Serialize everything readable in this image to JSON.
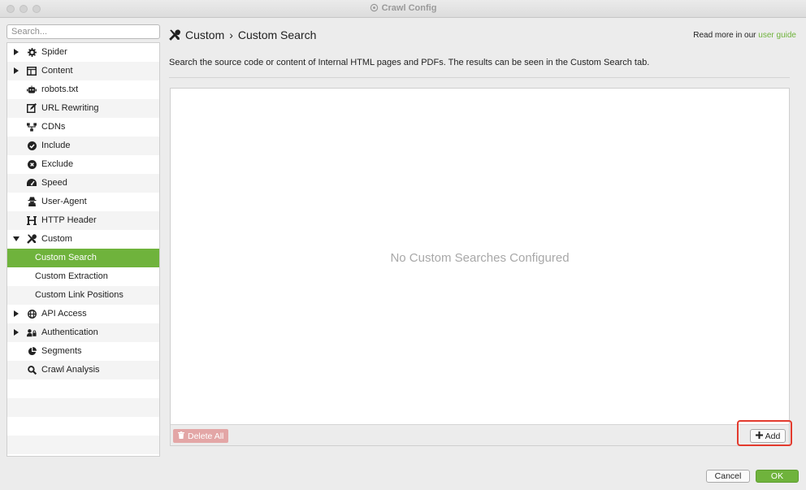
{
  "window": {
    "title": "Crawl Config"
  },
  "sidebar": {
    "search_placeholder": "Search...",
    "items": [
      {
        "label": "Spider",
        "icon": "gear-icon",
        "arrow": "right"
      },
      {
        "label": "Content",
        "icon": "content-icon",
        "arrow": "right"
      },
      {
        "label": "robots.txt",
        "icon": "robot-icon"
      },
      {
        "label": "URL Rewriting",
        "icon": "edit-icon"
      },
      {
        "label": "CDNs",
        "icon": "network-icon"
      },
      {
        "label": "Include",
        "icon": "check-circle-icon"
      },
      {
        "label": "Exclude",
        "icon": "x-circle-icon"
      },
      {
        "label": "Speed",
        "icon": "speedometer-icon"
      },
      {
        "label": "User-Agent",
        "icon": "user-secret-icon"
      },
      {
        "label": "HTTP Header",
        "icon": "header-icon"
      },
      {
        "label": "Custom",
        "icon": "tools-icon",
        "arrow": "down"
      },
      {
        "label": "Custom Search",
        "child": true,
        "selected": true
      },
      {
        "label": "Custom Extraction",
        "child": true
      },
      {
        "label": "Custom Link Positions",
        "child": true
      },
      {
        "label": "API Access",
        "icon": "globe-icon",
        "arrow": "right"
      },
      {
        "label": "Authentication",
        "icon": "user-lock-icon",
        "arrow": "right"
      },
      {
        "label": "Segments",
        "icon": "pie-chart-icon"
      },
      {
        "label": "Crawl Analysis",
        "icon": "magnifier-icon"
      }
    ]
  },
  "header": {
    "breadcrumb_parent": "Custom",
    "breadcrumb_separator": "›",
    "breadcrumb_current": "Custom Search",
    "guide_prefix": "Read more in our",
    "guide_link": "user guide"
  },
  "main": {
    "description": "Search the source code or content of Internal HTML pages and PDFs. The results can be seen in the Custom Search tab.",
    "empty_message": "No Custom Searches Configured",
    "delete_all_label": "Delete All",
    "add_label": "Add"
  },
  "footer": {
    "cancel_label": "Cancel",
    "ok_label": "OK"
  },
  "colors": {
    "accent": "#6fb33c",
    "highlight": "#e33b2e",
    "delete": "#e3a6a6"
  }
}
